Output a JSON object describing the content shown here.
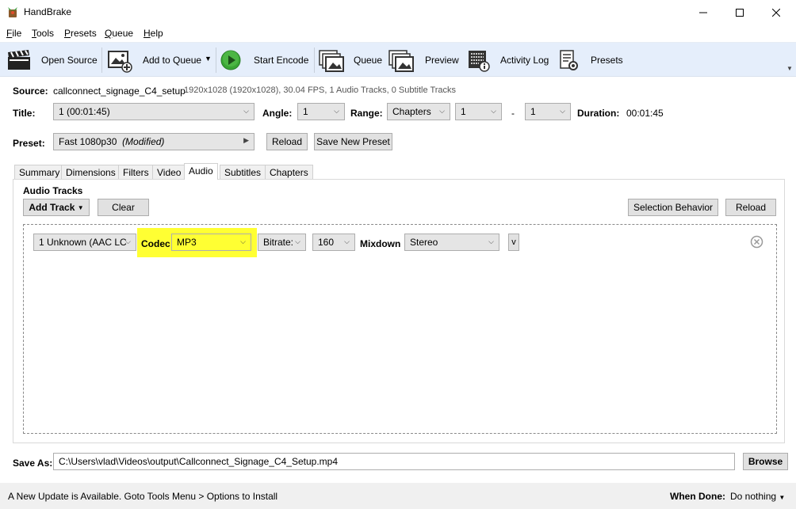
{
  "window": {
    "title": "HandBrake",
    "controls": {
      "minimize": "—",
      "maximize": "☐",
      "close": "✕"
    }
  },
  "menu": [
    {
      "label": "File",
      "accel": "F",
      "rest": "ile"
    },
    {
      "label": "Tools",
      "accel": "T",
      "rest": "ools"
    },
    {
      "label": "Presets",
      "accel": "P",
      "rest": "resets"
    },
    {
      "label": "Queue",
      "accel": "Q",
      "rest": "ueue"
    },
    {
      "label": "Help",
      "accel": "H",
      "rest": "elp"
    }
  ],
  "toolbar": {
    "open_source": "Open Source",
    "add_to_queue": "Add to Queue",
    "start_encode": "Start Encode",
    "queue": "Queue",
    "preview": "Preview",
    "activity_log": "Activity Log",
    "presets": "Presets"
  },
  "source": {
    "label": "Source:",
    "name": "callconnect_signage_C4_setup",
    "info": "1920x1028 (1920x1028), 30.04 FPS, 1 Audio Tracks, 0 Subtitle Tracks"
  },
  "title_row": {
    "title_label": "Title:",
    "title_value": "1  (00:01:45)",
    "angle_label": "Angle:",
    "angle_value": "1",
    "range_label": "Range:",
    "range_value": "Chapters",
    "range_start": "1",
    "range_sep": "-",
    "range_end": "1",
    "duration_label": "Duration:",
    "duration_value": "00:01:45"
  },
  "preset": {
    "label": "Preset:",
    "value": "Fast 1080p30",
    "modified": "(Modified)",
    "reload": "Reload",
    "save_new": "Save New Preset"
  },
  "tabs": [
    "Summary",
    "Dimensions",
    "Filters",
    "Video",
    "Audio",
    "Subtitles",
    "Chapters"
  ],
  "active_tab": "Audio",
  "audio": {
    "section_title": "Audio Tracks",
    "add_track": "Add Track",
    "clear": "Clear",
    "selection_behavior": "Selection Behavior",
    "reload": "Reload",
    "track": {
      "source": "1 Unknown (AAC LC",
      "codec_label": "Codec",
      "codec": "MP3",
      "bitrate_label": "Bitrate:",
      "bitrate": "160",
      "mixdown_label": "Mixdown",
      "mixdown": "Stereo",
      "more": "v"
    }
  },
  "save_as": {
    "label": "Save As:",
    "path": "C:\\Users\\vlad\\Videos\\output\\Callconnect_Signage_C4_Setup.mp4",
    "browse": "Browse"
  },
  "status": {
    "message": "A New Update is Available. Goto Tools Menu > Options to Install",
    "when_done_label": "When Done:",
    "when_done_value": "Do nothing"
  },
  "colors": {
    "toolbar_bg": "#e5eefb",
    "highlight": "#ffff33",
    "play_green": "#3aa635"
  }
}
